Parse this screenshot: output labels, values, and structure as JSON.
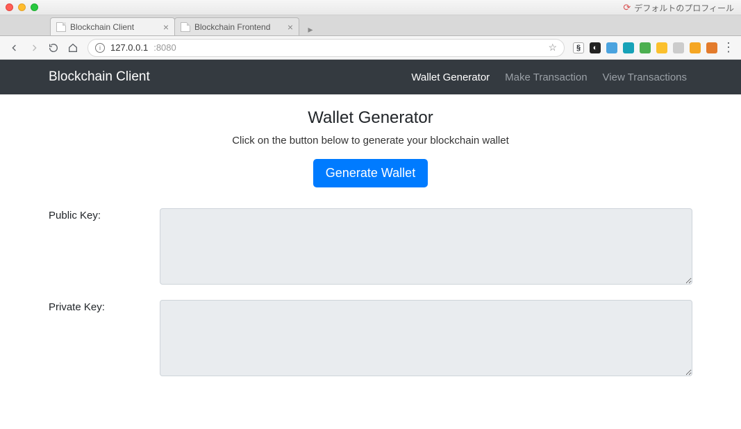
{
  "window": {
    "profile_label": "デフォルトのプロフィール"
  },
  "tabs": [
    {
      "title": "Blockchain Client",
      "active": true
    },
    {
      "title": "Blockchain Frontend",
      "active": false
    }
  ],
  "omnibox": {
    "host": "127.0.0.1",
    "port": ":8080"
  },
  "navbar": {
    "brand": "Blockchain Client",
    "links": [
      {
        "label": "Wallet Generator",
        "active": true
      },
      {
        "label": "Make Transaction",
        "active": false
      },
      {
        "label": "View Transactions",
        "active": false
      }
    ]
  },
  "page": {
    "heading": "Wallet Generator",
    "subtext": "Click on the button below to generate your blockchain wallet",
    "generate_label": "Generate Wallet",
    "public_key_label": "Public Key:",
    "public_key_value": "",
    "private_key_label": "Private Key:",
    "private_key_value": ""
  }
}
